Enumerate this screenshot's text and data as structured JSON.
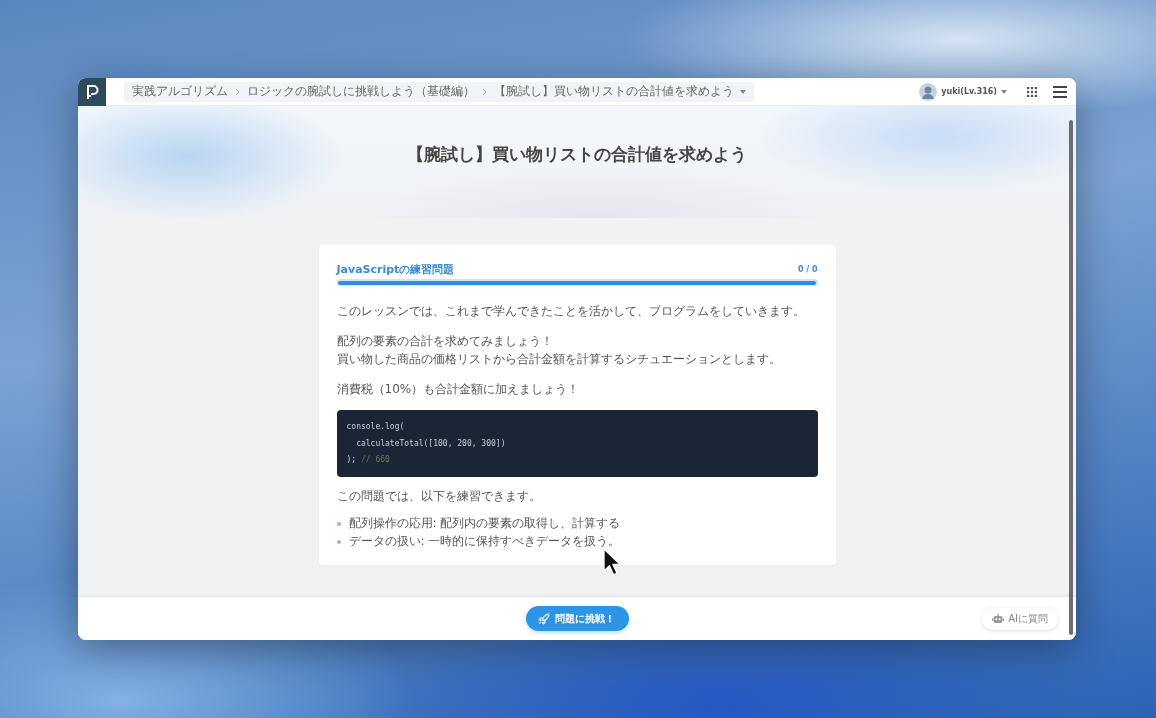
{
  "header": {
    "breadcrumbs": [
      "実践アルゴリズム",
      "ロジックの腕試しに挑戦しよう（基礎編）",
      "【腕試し】買い物リストの合計値を求めよう"
    ],
    "user": "yuki(Lv.316)"
  },
  "hero": {
    "title": "【腕試し】買い物リストの合計値を求めよう"
  },
  "lesson": {
    "category": "JavaScriptの練習問題",
    "count": "0 / 0",
    "progress": {
      "level": 1
    },
    "paragraphs": [
      [
        "このレッスンでは、これまで学んできたことを活かして、プログラムをしていきます。"
      ],
      [
        "配列の要素の合計を求めてみましょう！",
        "買い物した商品の価格リストから合計金額を計算するシチュエーションとします。"
      ],
      [
        "消費税（10%）も合計金額に加えましょう！"
      ]
    ],
    "code": [
      [
        {
          "kind": "plain",
          "text": "console.log("
        }
      ],
      [
        {
          "kind": "plain",
          "text": "  calculateTotal([100, 200, 300])"
        }
      ],
      [
        {
          "kind": "plain",
          "text": "); "
        },
        {
          "kind": "comment",
          "text": "// 660"
        }
      ]
    ],
    "practice_intro": "この問題では、以下を練習できます。",
    "practice_items": [
      "配列操作の応用: 配列内の要素の取得し、計算する",
      "データの扱い: 一時的に保持すべきデータを扱う。"
    ]
  },
  "footer": {
    "challenge_button": "問題に挑戦！",
    "ask_ai_button": "AIに質問"
  }
}
